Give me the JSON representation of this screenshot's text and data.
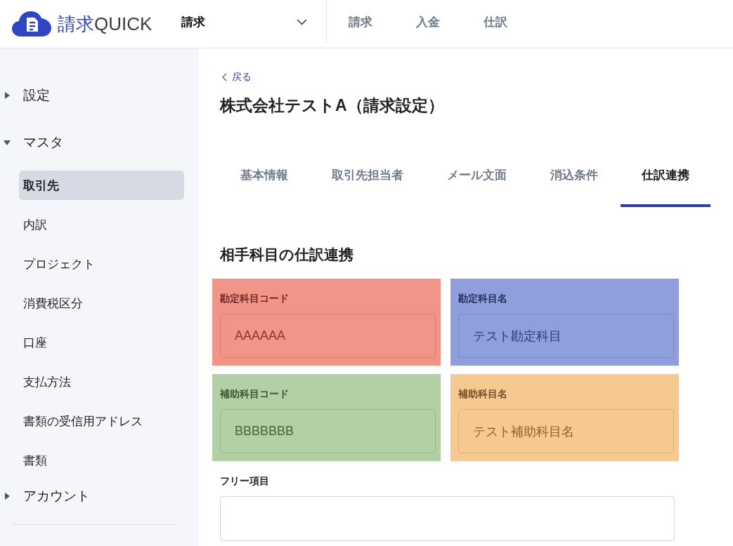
{
  "header": {
    "logo": {
      "text_main": "請求",
      "text_sub": "QUICK"
    },
    "service_select": {
      "value": "請求"
    },
    "nav": [
      {
        "label": "請求",
        "selected": false
      },
      {
        "label": "入金",
        "selected": false
      },
      {
        "label": "仕訳",
        "selected": false
      }
    ]
  },
  "sidebar": {
    "sections": [
      {
        "label": "設定",
        "expanded": false
      },
      {
        "label": "マスタ",
        "expanded": true,
        "children": [
          {
            "label": "取引先",
            "selected": true
          },
          {
            "label": "内訳",
            "selected": false
          },
          {
            "label": "プロジェクト",
            "selected": false
          },
          {
            "label": "消費税区分",
            "selected": false
          },
          {
            "label": "口座",
            "selected": false
          },
          {
            "label": "支払方法",
            "selected": false
          },
          {
            "label": "書類の受信用アドレス",
            "selected": false
          },
          {
            "label": "書類",
            "selected": false
          }
        ]
      },
      {
        "label": "アカウント",
        "expanded": false
      }
    ]
  },
  "page": {
    "back_link": "戻る",
    "title": "株式会社テストA（請求設定）",
    "tabs": [
      {
        "label": "基本情報",
        "selected": false
      },
      {
        "label": "取引先担当者",
        "selected": false
      },
      {
        "label": "メール文面",
        "selected": false
      },
      {
        "label": "消込条件",
        "selected": false
      },
      {
        "label": "仕訳連携",
        "selected": true
      }
    ],
    "section_title": "相手科目の仕訳連携",
    "fields": [
      {
        "label": "勘定科目コード",
        "value": "AAAAAA",
        "color": "#f29589"
      },
      {
        "label": "勘定科目名",
        "value": "テスト勘定科目",
        "color": "#8f9fdd"
      },
      {
        "label": "補助科目コード",
        "value": "BBBBBBB",
        "color": "#b3cfa5"
      },
      {
        "label": "補助科目名",
        "value": "テスト補助科目名",
        "color": "#f6c990"
      }
    ],
    "free_field": {
      "label": "フリー項目"
    }
  }
}
